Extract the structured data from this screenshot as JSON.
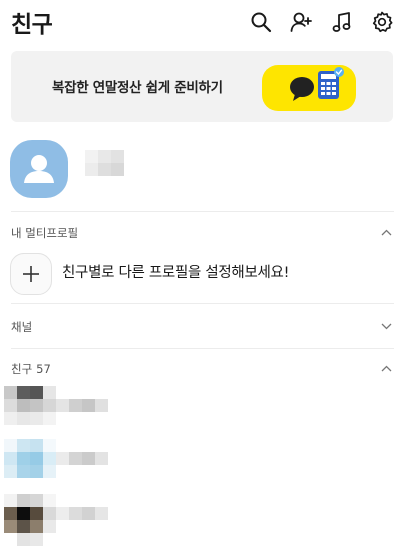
{
  "header": {
    "title": "친구",
    "icons": [
      "search-icon",
      "add-friend-icon",
      "music-icon",
      "settings-icon"
    ]
  },
  "banner": {
    "text": "복잡한 연말정산 쉽게 준비하기",
    "colors": {
      "background": "#f2f2f2",
      "art": "#fee500"
    }
  },
  "sections": {
    "multi_profile": {
      "label": "내 멀티프로필",
      "add_text": "친구별로 다른 프로필을 설정해보세요!"
    },
    "channel": {
      "label": "채널"
    },
    "friends": {
      "label": "친구",
      "count": "57"
    }
  },
  "colors": {
    "avatar": "#8fbde5",
    "divider": "#ececec"
  }
}
